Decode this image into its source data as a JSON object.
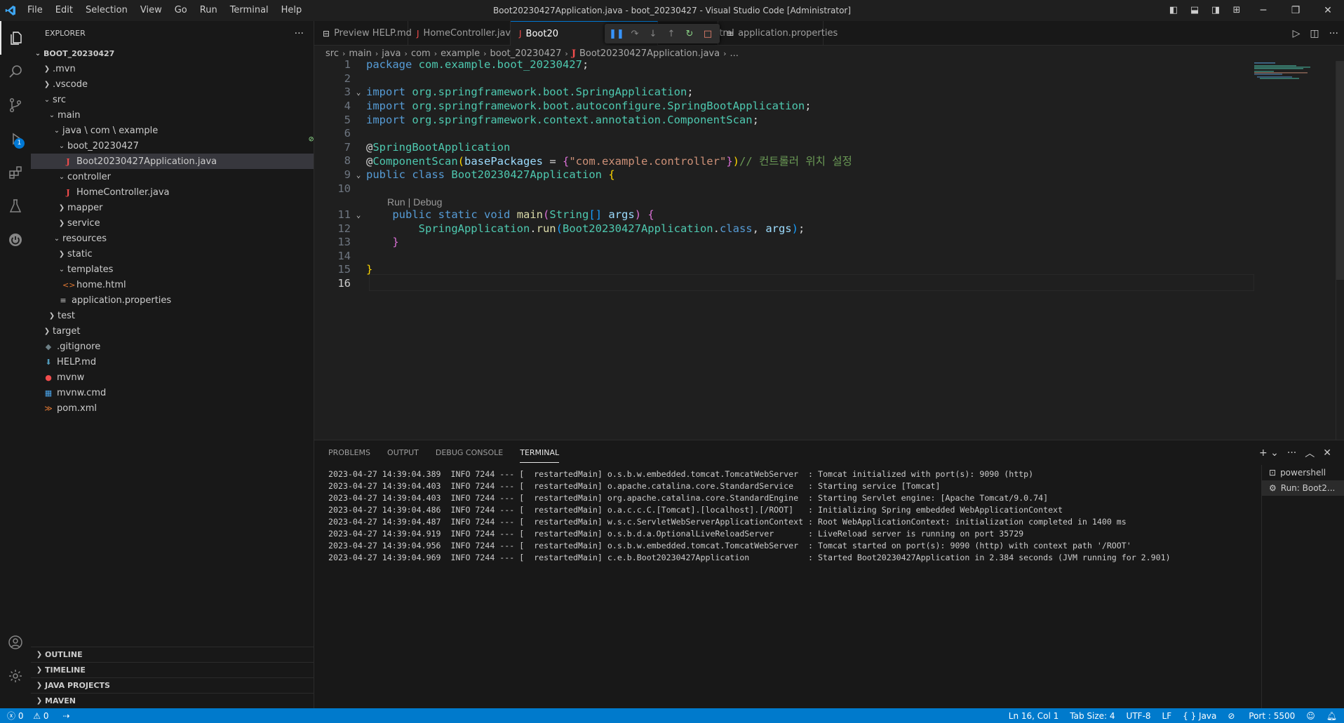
{
  "window": {
    "title": "Boot20230427Application.java - boot_20230427 - Visual Studio Code [Administrator]",
    "menu": [
      "File",
      "Edit",
      "Selection",
      "View",
      "Go",
      "Run",
      "Terminal",
      "Help"
    ]
  },
  "activity": {
    "debug_badge": "1"
  },
  "sidebar": {
    "title": "EXPLORER",
    "more": "···",
    "tree": [
      {
        "label": "BOOT_20230427",
        "depth": 0,
        "type": "root",
        "open": true
      },
      {
        "label": ".mvn",
        "depth": 1,
        "type": "folder",
        "open": false
      },
      {
        "label": ".vscode",
        "depth": 1,
        "type": "folder",
        "open": false
      },
      {
        "label": "src",
        "depth": 1,
        "type": "folder",
        "open": true
      },
      {
        "label": "main",
        "depth": 2,
        "type": "folder",
        "open": true
      },
      {
        "label": "java \\ com \\ example",
        "depth": 3,
        "type": "folder",
        "open": true
      },
      {
        "label": "boot_20230427",
        "depth": 4,
        "type": "folder",
        "open": true
      },
      {
        "label": "Boot20230427Application.java",
        "depth": 5,
        "type": "java",
        "selected": true
      },
      {
        "label": "controller",
        "depth": 4,
        "type": "folder",
        "open": true
      },
      {
        "label": "HomeController.java",
        "depth": 5,
        "type": "java"
      },
      {
        "label": "mapper",
        "depth": 4,
        "type": "folder",
        "open": false
      },
      {
        "label": "service",
        "depth": 4,
        "type": "folder",
        "open": false
      },
      {
        "label": "resources",
        "depth": 3,
        "type": "folder",
        "open": true
      },
      {
        "label": "static",
        "depth": 4,
        "type": "folder",
        "open": false
      },
      {
        "label": "templates",
        "depth": 4,
        "type": "folder",
        "open": true
      },
      {
        "label": "home.html",
        "depth": 5,
        "type": "html"
      },
      {
        "label": "application.properties",
        "depth": 4,
        "type": "prop"
      },
      {
        "label": "test",
        "depth": 2,
        "type": "folder",
        "open": false
      },
      {
        "label": "target",
        "depth": 1,
        "type": "folder",
        "open": false
      },
      {
        "label": ".gitignore",
        "depth": 1,
        "type": "git"
      },
      {
        "label": "HELP.md",
        "depth": 1,
        "type": "md"
      },
      {
        "label": "mvnw",
        "depth": 1,
        "type": "mvnw"
      },
      {
        "label": "mvnw.cmd",
        "depth": 1,
        "type": "win"
      },
      {
        "label": "pom.xml",
        "depth": 1,
        "type": "xml"
      }
    ],
    "sections": [
      "OUTLINE",
      "TIMELINE",
      "JAVA PROJECTS",
      "MAVEN"
    ]
  },
  "tabs": [
    {
      "label": "Preview HELP.md",
      "icon": "preview-icon",
      "active": false
    },
    {
      "label": "HomeController.java",
      "icon": "java-icon",
      "active": false
    },
    {
      "label": "Boot20",
      "icon": "java-icon",
      "active": true
    },
    {
      "label": "home.html",
      "icon": "html-icon",
      "active": false
    },
    {
      "label": "application.properties",
      "icon": "properties-icon",
      "active": false
    }
  ],
  "breadcrumb": [
    "src",
    "main",
    "java",
    "com",
    "example",
    "boot_20230427",
    "Boot20230427Application.java",
    "..."
  ],
  "editor": {
    "codelens": "Run | Debug",
    "current_line": "16",
    "lines": [
      {
        "n": "1",
        "tokens": [
          [
            "k",
            "package"
          ],
          [
            "p",
            " "
          ],
          [
            "pk",
            "com.example.boot_20230427"
          ],
          [
            "p",
            ";"
          ]
        ]
      },
      {
        "n": "2",
        "tokens": []
      },
      {
        "n": "3",
        "fold": true,
        "tokens": [
          [
            "k",
            "import"
          ],
          [
            "p",
            " "
          ],
          [
            "pk",
            "org.springframework.boot.SpringApplication"
          ],
          [
            "p",
            ";"
          ]
        ]
      },
      {
        "n": "4",
        "tokens": [
          [
            "k",
            "import"
          ],
          [
            "p",
            " "
          ],
          [
            "pk",
            "org.springframework.boot.autoconfigure.SpringBootApplication"
          ],
          [
            "p",
            ";"
          ]
        ]
      },
      {
        "n": "5",
        "tokens": [
          [
            "k",
            "import"
          ],
          [
            "p",
            " "
          ],
          [
            "pk",
            "org.springframework.context.annotation.ComponentScan"
          ],
          [
            "p",
            ";"
          ]
        ]
      },
      {
        "n": "6",
        "tokens": []
      },
      {
        "n": "7",
        "tokens": [
          [
            "p",
            "@"
          ],
          [
            "t",
            "SpringBootApplication"
          ]
        ]
      },
      {
        "n": "8",
        "tokens": [
          [
            "p",
            "@"
          ],
          [
            "t",
            "ComponentScan"
          ],
          [
            "br1",
            "("
          ],
          [
            "v",
            "basePackages"
          ],
          [
            "p",
            " = "
          ],
          [
            "br2",
            "{"
          ],
          [
            "s",
            "\"com.example.controller\""
          ],
          [
            "br2",
            "}"
          ],
          [
            "br1",
            ")"
          ],
          [
            "c",
            "// 컨트롤러 위치 설정"
          ]
        ]
      },
      {
        "n": "9",
        "fold": true,
        "tokens": [
          [
            "k",
            "public"
          ],
          [
            "p",
            " "
          ],
          [
            "k",
            "class"
          ],
          [
            "p",
            " "
          ],
          [
            "t",
            "Boot20230427Application"
          ],
          [
            "p",
            " "
          ],
          [
            "br1",
            "{"
          ]
        ]
      },
      {
        "n": "10",
        "tokens": []
      },
      {
        "n": "11",
        "fold": true,
        "tokens": [
          [
            "p",
            "    "
          ],
          [
            "k",
            "public"
          ],
          [
            "p",
            " "
          ],
          [
            "k",
            "static"
          ],
          [
            "p",
            " "
          ],
          [
            "k",
            "void"
          ],
          [
            "p",
            " "
          ],
          [
            "f",
            "main"
          ],
          [
            "br2",
            "("
          ],
          [
            "t",
            "String"
          ],
          [
            "br3",
            "[]"
          ],
          [
            "p",
            " "
          ],
          [
            "v",
            "args"
          ],
          [
            "br2",
            ")"
          ],
          [
            "p",
            " "
          ],
          [
            "br2",
            "{"
          ]
        ]
      },
      {
        "n": "12",
        "tokens": [
          [
            "p",
            "        "
          ],
          [
            "t",
            "SpringApplication"
          ],
          [
            "p",
            "."
          ],
          [
            "f",
            "run"
          ],
          [
            "br3",
            "("
          ],
          [
            "t",
            "Boot20230427Application"
          ],
          [
            "p",
            "."
          ],
          [
            "k",
            "class"
          ],
          [
            "p",
            ", "
          ],
          [
            "v",
            "args"
          ],
          [
            "br3",
            ")"
          ],
          [
            "p",
            ";"
          ]
        ]
      },
      {
        "n": "13",
        "tokens": [
          [
            "p",
            "    "
          ],
          [
            "br2",
            "}"
          ]
        ]
      },
      {
        "n": "14",
        "tokens": []
      },
      {
        "n": "15",
        "tokens": [
          [
            "br1",
            "}"
          ]
        ]
      },
      {
        "n": "16",
        "tokens": []
      }
    ]
  },
  "panel": {
    "tabs": [
      "PROBLEMS",
      "OUTPUT",
      "DEBUG CONSOLE",
      "TERMINAL"
    ],
    "active_tab": "TERMINAL",
    "terminal_lines": [
      "2023-04-27 14:39:04.389  INFO 7244 --- [  restartedMain] o.s.b.w.embedded.tomcat.TomcatWebServer  : Tomcat initialized with port(s): 9090 (http)",
      "2023-04-27 14:39:04.403  INFO 7244 --- [  restartedMain] o.apache.catalina.core.StandardService   : Starting service [Tomcat]",
      "2023-04-27 14:39:04.403  INFO 7244 --- [  restartedMain] org.apache.catalina.core.StandardEngine  : Starting Servlet engine: [Apache Tomcat/9.0.74]",
      "2023-04-27 14:39:04.486  INFO 7244 --- [  restartedMain] o.a.c.c.C.[Tomcat].[localhost].[/ROOT]   : Initializing Spring embedded WebApplicationContext",
      "2023-04-27 14:39:04.487  INFO 7244 --- [  restartedMain] w.s.c.ServletWebServerApplicationContext : Root WebApplicationContext: initialization completed in 1400 ms",
      "2023-04-27 14:39:04.919  INFO 7244 --- [  restartedMain] o.s.b.d.a.OptionalLiveReloadServer       : LiveReload server is running on port 35729",
      "2023-04-27 14:39:04.956  INFO 7244 --- [  restartedMain] o.s.b.w.embedded.tomcat.TomcatWebServer  : Tomcat started on port(s): 9090 (http) with context path '/ROOT'",
      "2023-04-27 14:39:04.969  INFO 7244 --- [  restartedMain] c.e.b.Boot20230427Application            : Started Boot20230427Application in 2.384 seconds (JVM running for 2.901)"
    ],
    "terminals": [
      {
        "label": "powershell",
        "active": false
      },
      {
        "label": "Run: Boot2...",
        "active": true
      }
    ]
  },
  "statusbar": {
    "errors": "0",
    "warnings": "0",
    "position": "Ln 16, Col 1",
    "tab_size": "Tab Size: 4",
    "encoding": "UTF-8",
    "eol": "LF",
    "language": "{ } Java",
    "port": "Port : 5500"
  },
  "colors": {
    "accent": "#007acc",
    "editor_bg": "#1f1f1f",
    "sidebar_bg": "#181818"
  }
}
